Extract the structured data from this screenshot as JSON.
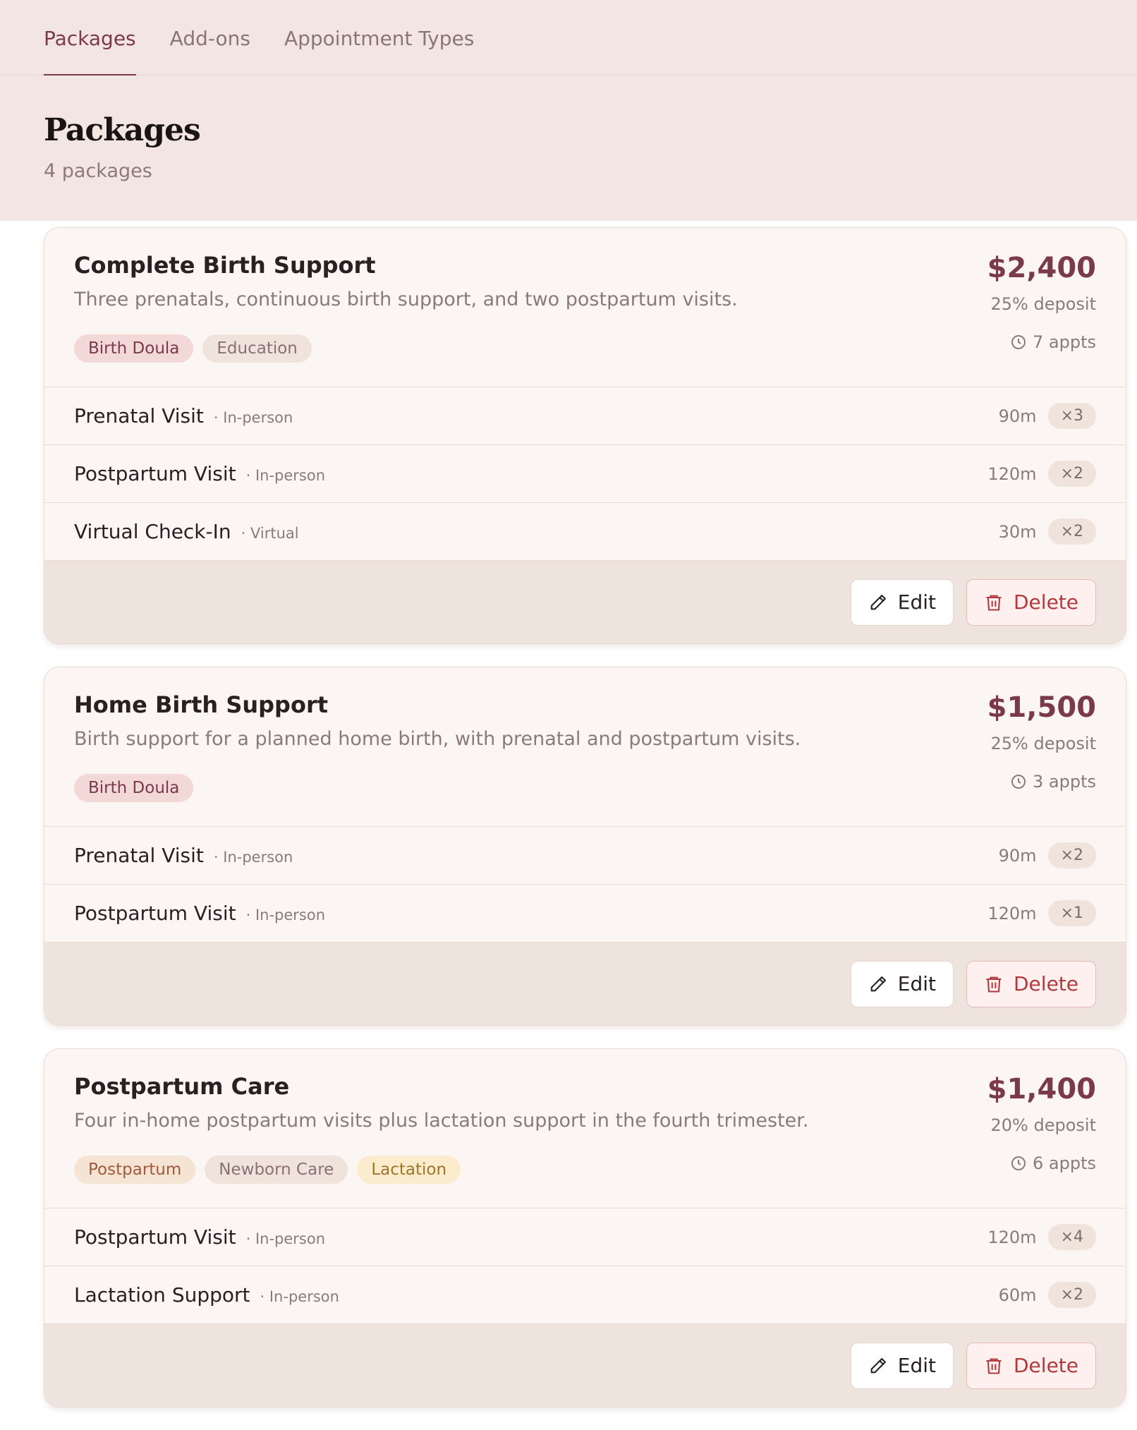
{
  "tabs": [
    {
      "label": "Packages",
      "active": true
    },
    {
      "label": "Add-ons",
      "active": false
    },
    {
      "label": "Appointment Types",
      "active": false
    }
  ],
  "header": {
    "title": "Packages",
    "subtitle": "4 packages"
  },
  "buttons": {
    "edit": "Edit",
    "delete": "Delete"
  },
  "icons": {
    "clock": "clock-icon",
    "edit": "pencil-icon",
    "delete": "trash-icon"
  },
  "colors": {
    "accent": "#7a3a4c",
    "danger": "#b13a3e",
    "background": "#f3e6e2"
  },
  "packages": [
    {
      "title": "Complete Birth Support",
      "description": "Three prenatals, continuous birth support, and two postpartum visits.",
      "price": "$2,400",
      "deposit": "25% deposit",
      "appts": "7 appts",
      "tags": [
        {
          "label": "Birth Doula",
          "style": "rose"
        },
        {
          "label": "Education",
          "style": "sand"
        }
      ],
      "items": [
        {
          "name": "Prenatal Visit",
          "mode": "· In-person",
          "duration": "90m",
          "qty": "×3"
        },
        {
          "name": "Postpartum Visit",
          "mode": "· In-person",
          "duration": "120m",
          "qty": "×2"
        },
        {
          "name": "Virtual Check-In",
          "mode": "· Virtual",
          "duration": "30m",
          "qty": "×2"
        }
      ]
    },
    {
      "title": "Home Birth Support",
      "description": "Birth support for a planned home birth, with prenatal and postpartum visits.",
      "price": "$1,500",
      "deposit": "25% deposit",
      "appts": "3 appts",
      "tags": [
        {
          "label": "Birth Doula",
          "style": "rose"
        }
      ],
      "items": [
        {
          "name": "Prenatal Visit",
          "mode": "· In-person",
          "duration": "90m",
          "qty": "×2"
        },
        {
          "name": "Postpartum Visit",
          "mode": "· In-person",
          "duration": "120m",
          "qty": "×1"
        }
      ]
    },
    {
      "title": "Postpartum Care",
      "description": "Four in-home postpartum visits plus lactation support in the fourth trimester.",
      "price": "$1,400",
      "deposit": "20% deposit",
      "appts": "6 appts",
      "tags": [
        {
          "label": "Postpartum",
          "style": "peach"
        },
        {
          "label": "Newborn Care",
          "style": "sand"
        },
        {
          "label": "Lactation",
          "style": "gold"
        }
      ],
      "items": [
        {
          "name": "Postpartum Visit",
          "mode": "· In-person",
          "duration": "120m",
          "qty": "×4"
        },
        {
          "name": "Lactation Support",
          "mode": "· In-person",
          "duration": "60m",
          "qty": "×2"
        }
      ]
    }
  ]
}
